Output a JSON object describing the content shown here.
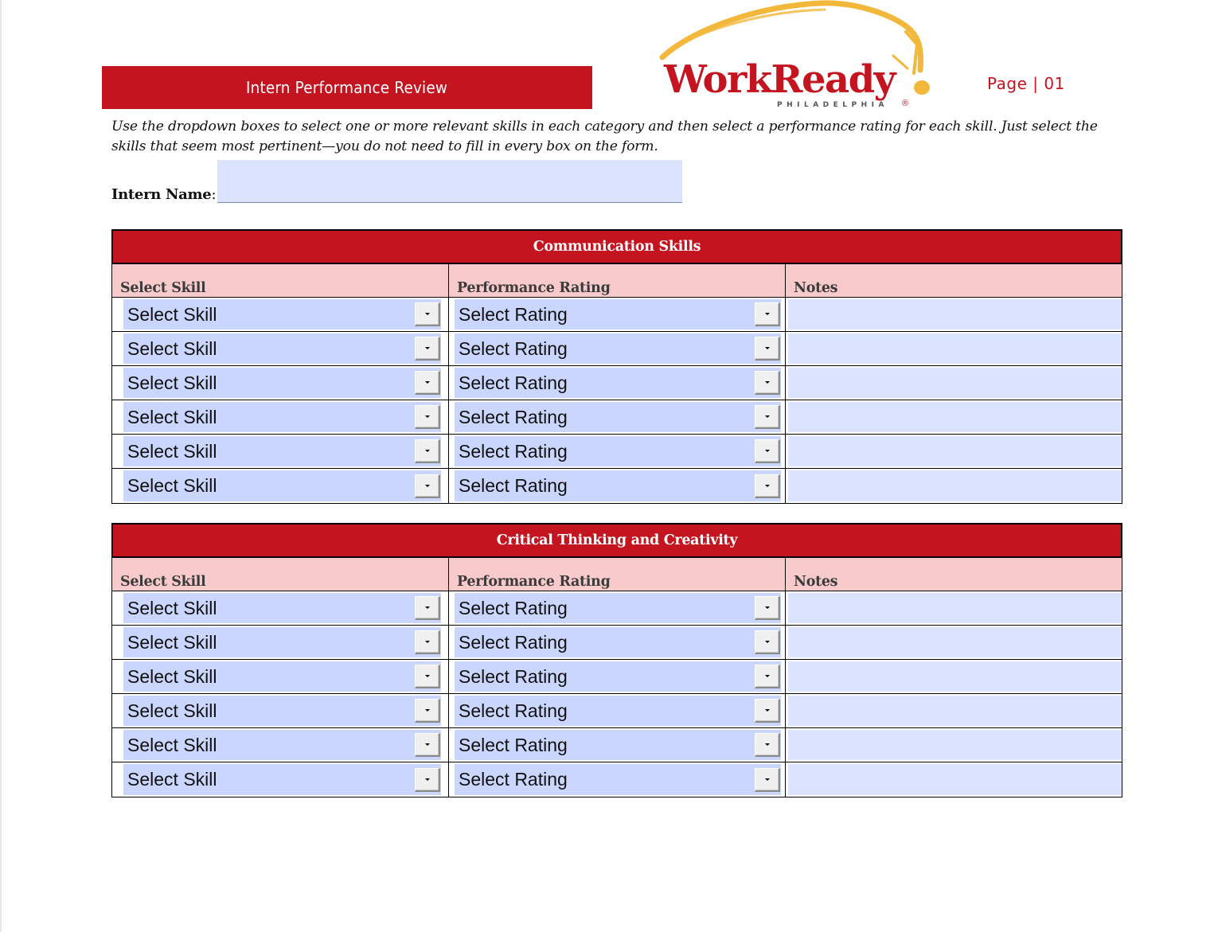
{
  "header": {
    "title": "Intern Performance Review",
    "logo": {
      "word": "WorkReady",
      "sub": "PHILADELPHIA",
      "reg": "®"
    },
    "page_label": "Page | 01"
  },
  "instructions": "Use the dropdown boxes to select one or more relevant skills in each category and then select a performance rating for each skill. Just select the skills that seem most pertinent—you do not need to fill in every box on the form.",
  "intern_name": {
    "label": "Intern Name",
    "colon": ":",
    "value": ""
  },
  "colors": {
    "brand_red": "#C41420",
    "subheader_pink": "#F8CACB",
    "field_blue": "#CAD6FD",
    "notes_blue": "#DCE3FE",
    "logo_gold": "#F2B83C"
  },
  "sections": [
    {
      "title": "Communication Skills",
      "columns": [
        "Select Skill",
        "Performance Rating",
        "Notes"
      ],
      "rows": [
        {
          "skill": "Select Skill",
          "rating": "Select Rating",
          "notes": ""
        },
        {
          "skill": "Select Skill",
          "rating": "Select Rating",
          "notes": ""
        },
        {
          "skill": "Select Skill",
          "rating": "Select Rating",
          "notes": ""
        },
        {
          "skill": "Select Skill",
          "rating": "Select Rating",
          "notes": ""
        },
        {
          "skill": "Select Skill",
          "rating": "Select Rating",
          "notes": ""
        },
        {
          "skill": "Select Skill",
          "rating": "Select Rating",
          "notes": ""
        }
      ]
    },
    {
      "title": "Critical Thinking and Creativity",
      "columns": [
        "Select Skill",
        "Performance Rating",
        "Notes"
      ],
      "rows": [
        {
          "skill": "Select Skill",
          "rating": "Select Rating",
          "notes": ""
        },
        {
          "skill": "Select Skill",
          "rating": "Select Rating",
          "notes": ""
        },
        {
          "skill": "Select Skill",
          "rating": "Select Rating",
          "notes": ""
        },
        {
          "skill": "Select Skill",
          "rating": "Select Rating",
          "notes": ""
        },
        {
          "skill": "Select Skill",
          "rating": "Select Rating",
          "notes": ""
        },
        {
          "skill": "Select Skill",
          "rating": "Select Rating",
          "notes": ""
        }
      ]
    }
  ]
}
